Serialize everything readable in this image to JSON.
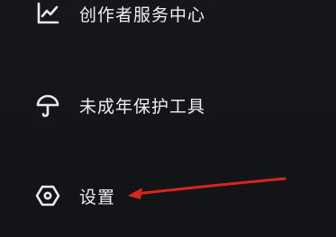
{
  "menu": {
    "items": [
      {
        "label": "创作者服务中心",
        "icon": "trend-chart-icon"
      },
      {
        "label": "未成年保护工具",
        "icon": "umbrella-icon"
      },
      {
        "label": "设置",
        "icon": "hexagon-settings-icon"
      }
    ]
  },
  "annotation": {
    "type": "arrow",
    "color": "#d9251c",
    "points_to": "设置"
  },
  "colors": {
    "background": "#15171c",
    "text": "#f0f0f0",
    "icon": "#ebebeb"
  }
}
